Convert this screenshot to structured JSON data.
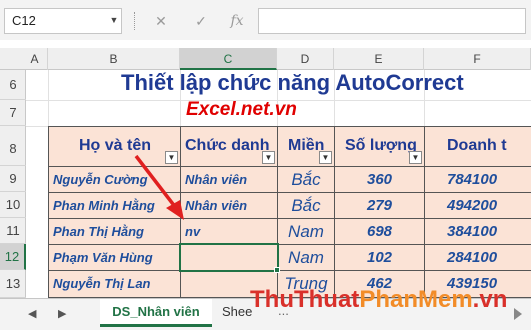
{
  "formula_bar": {
    "name_box": "C12",
    "fx_label": "fx",
    "formula_value": ""
  },
  "columns": [
    "A",
    "B",
    "C",
    "D",
    "E",
    "F"
  ],
  "rows": [
    "6",
    "7",
    "8",
    "9",
    "10",
    "11",
    "12",
    "13"
  ],
  "sheet_title": "Thiết lập chức năng AutoCorrect",
  "site_label": "Excel.net.vn",
  "table": {
    "headers": [
      "Họ và tên",
      "Chức danh",
      "Miền",
      "Số lượng",
      "Doanh t"
    ],
    "rows": [
      {
        "name": "Nguyễn Cường",
        "title": "Nhân viên",
        "region": "Bắc",
        "qty": "360",
        "revenue": "784100"
      },
      {
        "name": "Phan  Minh Hằng",
        "title": "Nhân viên",
        "region": "Bắc",
        "qty": "279",
        "revenue": "494200"
      },
      {
        "name": "Phan  Thị Hằng",
        "title": "nv",
        "region": "Nam",
        "qty": "698",
        "revenue": "384100"
      },
      {
        "name": "Phạm  Văn Hùng",
        "title": "",
        "region": "Nam",
        "qty": "102",
        "revenue": "284100"
      },
      {
        "name": "Nguyễn  Thị Lan",
        "title": "",
        "region": "Trung",
        "qty": "462",
        "revenue": "439150"
      }
    ]
  },
  "sheet_tabs": {
    "active": "DS_Nhân viên",
    "second": "Shee",
    "more": "..."
  },
  "watermark": {
    "part1": "ThuThuat",
    "part2": "PhanMem",
    "part3": ".vn"
  },
  "colors": {
    "accent": "#217346",
    "header_fill": "#fbe3d6",
    "title": "#1f3a93",
    "site": "#e00000"
  }
}
